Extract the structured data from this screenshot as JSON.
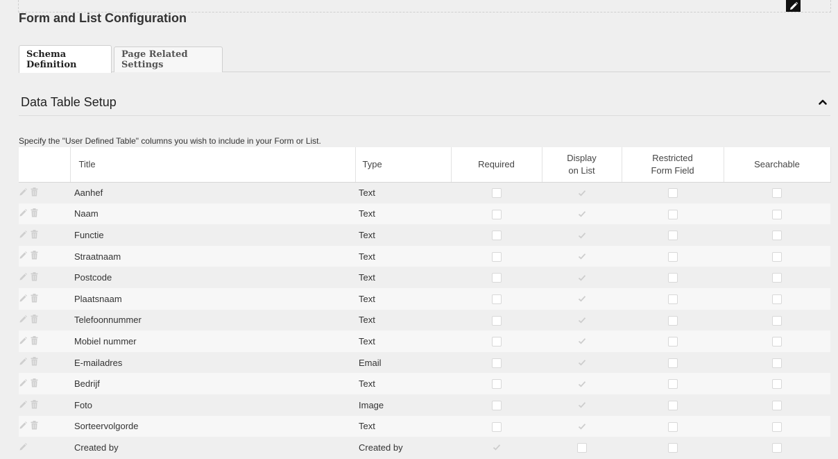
{
  "page": {
    "title": "Form and List Configuration"
  },
  "tabs": [
    {
      "label": "Schema Definition",
      "active": true
    },
    {
      "label": "Page Related Settings",
      "active": false
    }
  ],
  "section": {
    "title": "Data Table Setup"
  },
  "help_text": "Specify the \"User Defined Table\" columns you wish to include in your Form or List.",
  "table": {
    "headers": {
      "title": "Title",
      "type": "Type",
      "required": "Required",
      "display_line1": "Display",
      "display_line2": "on List",
      "restricted_line1": "Restricted",
      "restricted_line2": "Form Field",
      "searchable": "Searchable"
    },
    "rows": [
      {
        "title": "Aanhef",
        "type": "Text",
        "required": "checkbox",
        "display": "check",
        "restricted": "checkbox",
        "searchable": "checkbox",
        "deletable": true
      },
      {
        "title": "Naam",
        "type": "Text",
        "required": "checkbox",
        "display": "check",
        "restricted": "checkbox",
        "searchable": "checkbox",
        "deletable": true
      },
      {
        "title": "Functie",
        "type": "Text",
        "required": "checkbox",
        "display": "check",
        "restricted": "checkbox",
        "searchable": "checkbox",
        "deletable": true
      },
      {
        "title": "Straatnaam",
        "type": "Text",
        "required": "checkbox",
        "display": "check",
        "restricted": "checkbox",
        "searchable": "checkbox",
        "deletable": true
      },
      {
        "title": "Postcode",
        "type": "Text",
        "required": "checkbox",
        "display": "check",
        "restricted": "checkbox",
        "searchable": "checkbox",
        "deletable": true
      },
      {
        "title": "Plaatsnaam",
        "type": "Text",
        "required": "checkbox",
        "display": "check",
        "restricted": "checkbox",
        "searchable": "checkbox",
        "deletable": true
      },
      {
        "title": "Telefoonnummer",
        "type": "Text",
        "required": "checkbox",
        "display": "check",
        "restricted": "checkbox",
        "searchable": "checkbox",
        "deletable": true
      },
      {
        "title": "Mobiel nummer",
        "type": "Text",
        "required": "checkbox",
        "display": "check",
        "restricted": "checkbox",
        "searchable": "checkbox",
        "deletable": true
      },
      {
        "title": "E-mailadres",
        "type": "Email",
        "required": "checkbox",
        "display": "check",
        "restricted": "checkbox",
        "searchable": "checkbox",
        "deletable": true
      },
      {
        "title": "Bedrijf",
        "type": "Text",
        "required": "checkbox",
        "display": "check",
        "restricted": "checkbox",
        "searchable": "checkbox",
        "deletable": true
      },
      {
        "title": "Foto",
        "type": "Image",
        "required": "checkbox",
        "display": "check",
        "restricted": "checkbox",
        "searchable": "checkbox",
        "deletable": true
      },
      {
        "title": "Sorteervolgorde",
        "type": "Text",
        "required": "checkbox",
        "display": "check",
        "restricted": "checkbox",
        "searchable": "checkbox",
        "deletable": true
      },
      {
        "title": "Created by",
        "type": "Created by",
        "required": "check",
        "display": "checkbox",
        "restricted": "checkbox",
        "searchable": "checkbox",
        "deletable": false
      }
    ]
  },
  "icons": {
    "edit_module": "pencil-icon",
    "collapse": "chevron-up-icon",
    "row_edit": "pencil-icon",
    "row_delete": "trash-icon",
    "readonly_check": "checkmark-icon"
  },
  "colors": {
    "background": "#efefef",
    "header_bg": "#ffffff",
    "icon_muted": "#cfcfcf"
  }
}
